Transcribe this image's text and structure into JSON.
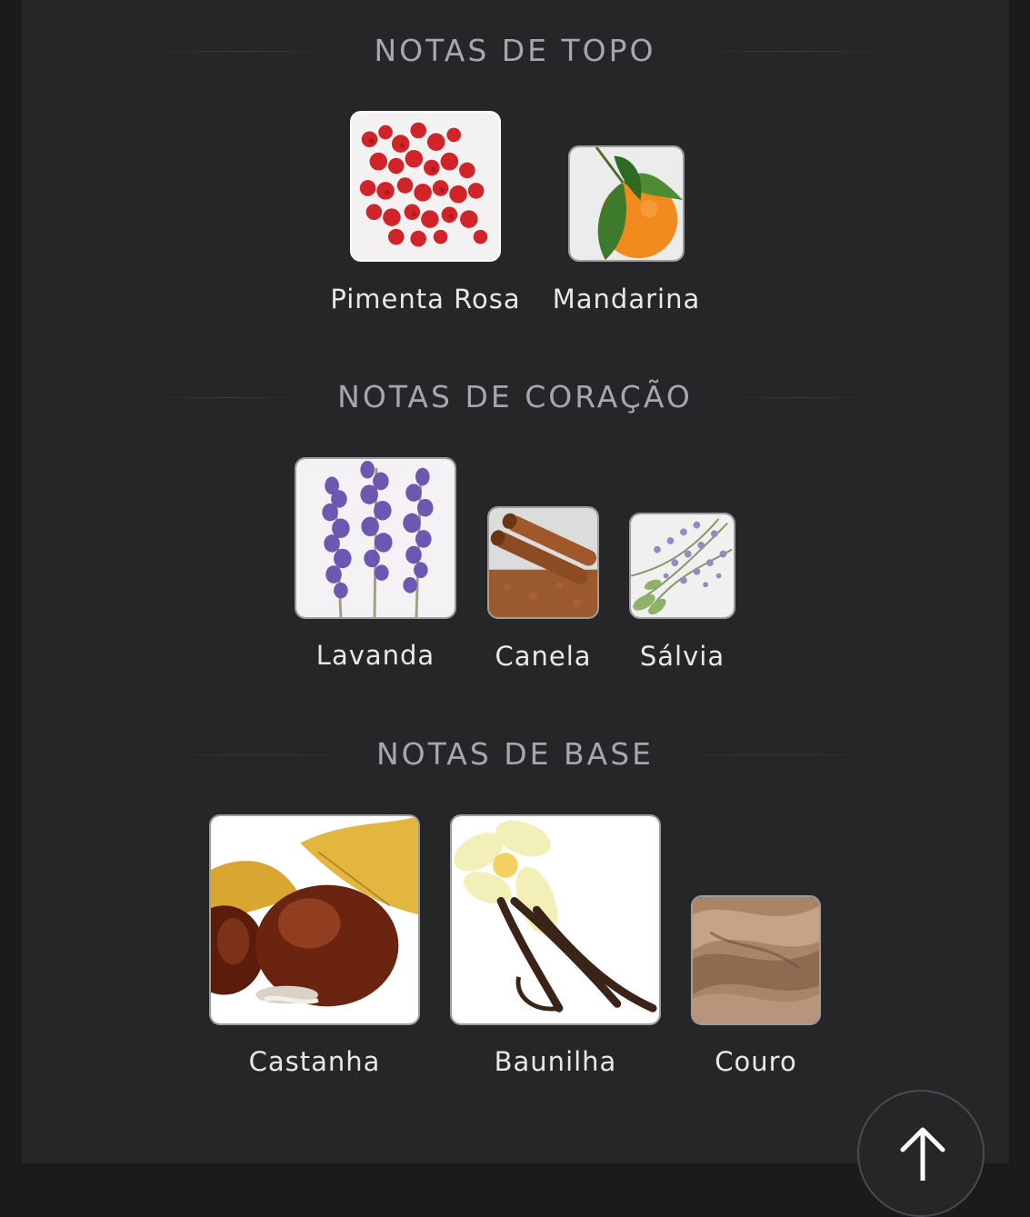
{
  "sections": [
    {
      "title": "NOTAS DE TOPO",
      "notes": [
        {
          "label": "Pimenta Rosa",
          "icon": "pink-pepper-icon"
        },
        {
          "label": "Mandarina",
          "icon": "mandarin-icon"
        }
      ]
    },
    {
      "title": "NOTAS DE CORAÇÃO",
      "notes": [
        {
          "label": "Lavanda",
          "icon": "lavender-icon"
        },
        {
          "label": "Canela",
          "icon": "cinnamon-icon"
        },
        {
          "label": "Sálvia",
          "icon": "sage-icon"
        }
      ]
    },
    {
      "title": "NOTAS DE BASE",
      "notes": [
        {
          "label": "Castanha",
          "icon": "chestnut-icon"
        },
        {
          "label": "Baunilha",
          "icon": "vanilla-icon"
        },
        {
          "label": "Couro",
          "icon": "leather-icon"
        }
      ]
    }
  ],
  "scroll_top_button": {
    "icon": "arrow-up-icon"
  }
}
